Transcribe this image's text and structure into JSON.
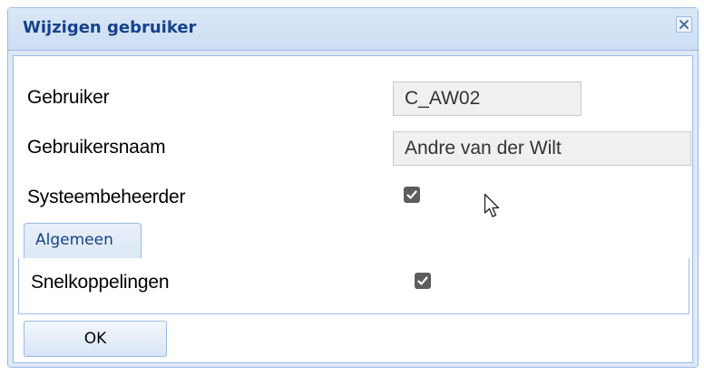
{
  "dialog": {
    "title": "Wijzigen gebruiker",
    "close_icon": "close-icon"
  },
  "form": {
    "user_label": "Gebruiker",
    "user_value": "C_AW02",
    "username_label": "Gebruikersnaam",
    "username_value": "Andre van der Wilt",
    "admin_label": "Systeembeheerder",
    "admin_checked": true
  },
  "tabs": [
    {
      "label": "Algemeen",
      "active": true
    }
  ],
  "general_tab": {
    "shortcuts_label": "Snelkoppelingen",
    "shortcuts_checked": true
  },
  "footer": {
    "ok_label": "OK"
  },
  "colors": {
    "title_text": "#15428b",
    "border": "#99bbe8",
    "checkbox": "#5d5d5d"
  },
  "icons": {
    "close": "close-icon",
    "checkbox": "checkmark-icon",
    "cursor": "mouse-cursor-icon"
  }
}
